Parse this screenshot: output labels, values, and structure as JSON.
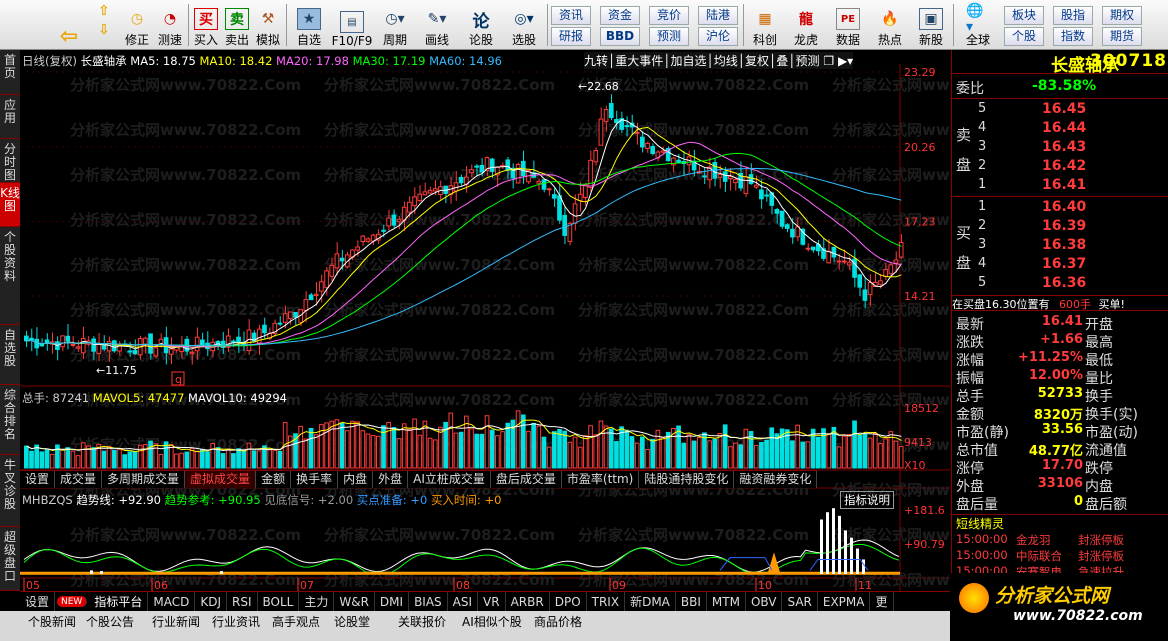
{
  "toolbar": {
    "buttons": [
      {
        "name": "back",
        "label": "",
        "icon": "back-arrow-icon"
      },
      {
        "name": "up",
        "label": "上翻",
        "icon": "up-arrow-icon"
      },
      {
        "name": "down",
        "label": "下翻",
        "icon": "down-arrow-icon"
      },
      {
        "name": "fix",
        "label": "修正",
        "icon": "clock-icon"
      },
      {
        "name": "measure",
        "label": "测速",
        "icon": "timer-icon"
      },
      {
        "name": "buy",
        "label": "买入",
        "icon": "buy-icon"
      },
      {
        "name": "sell",
        "label": "卖出",
        "icon": "sell-icon"
      },
      {
        "name": "sim",
        "label": "模拟",
        "icon": "hammer-icon"
      },
      {
        "name": "fav",
        "label": "自选",
        "icon": "star-icon"
      },
      {
        "name": "f10",
        "label": "F10/F9",
        "icon": "f10-icon"
      },
      {
        "name": "period",
        "label": "周期",
        "icon": "period-icon"
      },
      {
        "name": "draw",
        "label": "画线",
        "icon": "pen-icon"
      },
      {
        "name": "lunstock",
        "label": "论股",
        "icon": "lun-icon"
      },
      {
        "name": "pick",
        "label": "选股",
        "icon": "pick-icon"
      },
      {
        "name": "kechuang",
        "label": "科创",
        "icon": "kechuang-icon"
      },
      {
        "name": "longhu",
        "label": "龙虎",
        "icon": "dragon-icon"
      },
      {
        "name": "data",
        "label": "数据",
        "icon": "pe-icon"
      },
      {
        "name": "hot",
        "label": "热点",
        "icon": "hot-icon"
      },
      {
        "name": "newstock",
        "label": "新股",
        "icon": "newstock-icon"
      },
      {
        "name": "global",
        "label": "全球",
        "icon": "globe-icon"
      }
    ],
    "small_buttons": [
      "资讯",
      "资金",
      "竞价",
      "陆港",
      "研报",
      "BBD",
      "预测",
      "沪伦",
      "板块",
      "股指",
      "期权",
      "个股",
      "指数",
      "期货"
    ],
    "f10_tag": "F10/F9",
    "fav_label": "自选"
  },
  "leftnav": [
    "首页",
    "应用",
    "分时图",
    "K线图",
    "个股资料",
    "自选股",
    "综合排名",
    "牛叉诊股",
    "超级盘口"
  ],
  "chart_header": {
    "title": "日线(复权)",
    "stock": "长盛轴承",
    "ma5": "MA5: 18.75",
    "ma10": "MA10: 18.42",
    "ma20": "MA20: 17.98",
    "ma30": "MA30: 17.19",
    "ma60": "MA60: 14.96",
    "tools": [
      "九转",
      "重大事件",
      "加自选",
      "均线",
      "复权",
      "叠",
      "预测"
    ]
  },
  "watermark": "分析家公式网www.70822.Com",
  "price_axis": [
    "23.29",
    "20.26",
    "17.23",
    "14.21"
  ],
  "annotations": {
    "high": "22.68",
    "low": "11.75",
    "marker": "q"
  },
  "volume_header": {
    "total": "总手: 87241",
    "mavol5": "MAVOL5: 47477",
    "mavol10": "MAVOL10: 49294"
  },
  "volume_axis": [
    "18512",
    "9413",
    "X10"
  ],
  "subtabs": [
    "设置",
    "成交量",
    "多周期成交量",
    "虚拟成交量",
    "金额",
    "换手率",
    "内盘",
    "外盘",
    "AI立桩成交量",
    "盘后成交量",
    "市盈率(ttm)",
    "陆股通持股变化",
    "融资融券变化"
  ],
  "indicator_header": {
    "name": "MHBZQS",
    "trend": "趋势线: +92.90",
    "ref": "趋势参考: +90.95",
    "signal": "见底信号: +2.00",
    "ready": "买点准备: +0",
    "time": "买入时间: +0",
    "explain": "指标说明"
  },
  "indicator_axis": [
    "+181.6",
    "+90.79"
  ],
  "months": [
    "05",
    "06",
    "07",
    "08",
    "09",
    "10",
    "11"
  ],
  "bottom_tabs": [
    "设置",
    "NEW",
    "指标平台",
    "MACD",
    "KDJ",
    "RSI",
    "BOLL",
    "主力",
    "W&R",
    "DMI",
    "BIAS",
    "ASI",
    "VR",
    "ARBR",
    "DPO",
    "TRIX",
    "新DMA",
    "BBI",
    "MTM",
    "OBV",
    "SAR",
    "EXPMA",
    "更"
  ],
  "bottom_bar": [
    "个股新闻",
    "个股公告",
    "行业新闻",
    "行业资讯",
    "高手观点",
    "论股堂",
    "关联报价",
    "AI相似个股",
    "商品价格"
  ],
  "quote": {
    "name": "长盛轴承",
    "code": "300718",
    "weibi_label": "委比",
    "weibi": "-83.58%",
    "sell_label": "卖盘",
    "buy_label": "买盘",
    "sells": [
      [
        "5",
        "16.45"
      ],
      [
        "4",
        "16.44"
      ],
      [
        "3",
        "16.43"
      ],
      [
        "2",
        "16.42"
      ],
      [
        "1",
        "16.41"
      ]
    ],
    "buys": [
      [
        "1",
        "16.40"
      ],
      [
        "2",
        "16.39"
      ],
      [
        "3",
        "16.38"
      ],
      [
        "4",
        "16.37"
      ],
      [
        "5",
        "16.36"
      ]
    ],
    "notice_a": "在买盘16.30位置有",
    "notice_b": "600手",
    "notice_c": "买单!",
    "stats": [
      [
        "最新",
        "16.41",
        "开盘",
        ""
      ],
      [
        "涨跌",
        "+1.66",
        "最高",
        ""
      ],
      [
        "涨幅",
        "+11.25%",
        "最低",
        ""
      ],
      [
        "振幅",
        "12.00%",
        "量比",
        ""
      ],
      [
        "总手",
        "52733",
        "换手",
        ""
      ],
      [
        "金额",
        "8320万",
        "换手(实)",
        ""
      ],
      [
        "市盈(静)",
        "33.56",
        "市盈(动)",
        ""
      ],
      [
        "总市值",
        "48.77亿",
        "流通值",
        ""
      ],
      [
        "涨停",
        "17.70",
        "跌停",
        ""
      ],
      [
        "外盘",
        "33106",
        "内盘",
        ""
      ],
      [
        "盘后量",
        "0",
        "盘后额",
        ""
      ]
    ],
    "elf_title": "短线精灵",
    "elf": [
      [
        "15:00:00",
        "金龙羽",
        "封涨停板"
      ],
      [
        "15:00:00",
        "中际联合",
        "封涨停板"
      ],
      [
        "15:00:00",
        "安赛智电",
        "急速拉升"
      ]
    ]
  },
  "brand": {
    "text": "分析家公式网",
    "url": "www.70822.com"
  },
  "colors": {
    "up": "#ff3b3b",
    "down": "#00e0e0",
    "ma5": "#ffffff",
    "ma10": "#ffff00",
    "ma20": "#ff66ff",
    "ma30": "#00ff00",
    "ma60": "#33bbff",
    "grid": "#800000",
    "axis": "#ff3333"
  }
}
